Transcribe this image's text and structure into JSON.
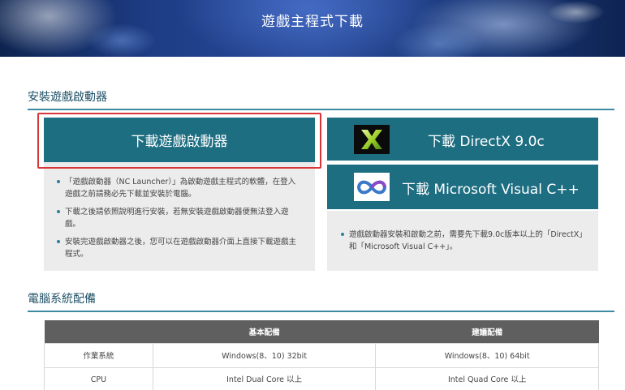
{
  "banner": {
    "title": "遊戲主程式下載"
  },
  "install_section": {
    "heading": "安裝遊戲啟動器",
    "launcher_button": "下載遊戲啟動器",
    "directx_button": "下載 DirectX 9.0c",
    "vc_button": "下載 Microsoft Visual C++",
    "launcher_notes": [
      "「遊戲啟動器（NC Launcher）」為啟動遊戲主程式的軟體，在登入遊戲之前請務必先下載並安裝於電腦。",
      "下載之後請依照說明進行安裝，若無安裝遊戲啟動器便無法登入遊戲。",
      "安裝完遊戲啟動器之後，您可以在遊戲啟動器介面上直接下載遊戲主程式。"
    ],
    "runtime_notes": [
      "遊戲啟動器安裝和啟動之前，需要先下載9.0c版本以上的「DirectX」和「Microsoft Visual C++」。"
    ]
  },
  "specs_section": {
    "heading": "電腦系統配備",
    "columns": [
      "",
      "基本配備",
      "建議配備"
    ],
    "rows": [
      {
        "label": "作業系統",
        "basic": "Windows(8、10) 32bit",
        "recommended": "Windows(8、10) 64bit"
      },
      {
        "label": "CPU",
        "basic": "Intel Dual Core 以上",
        "recommended": "Intel Quad Core 以上"
      }
    ]
  },
  "icons": {
    "directx": "directx-logo-icon",
    "visual_cpp": "visual-cpp-logo-icon",
    "bullet": "bullet-dot-icon"
  },
  "colors": {
    "button": "#1e6e82",
    "heading_line": "#3f8aa3",
    "highlight": "#d9363a",
    "panel": "#ececec",
    "table_header": "#5f5f5f"
  }
}
